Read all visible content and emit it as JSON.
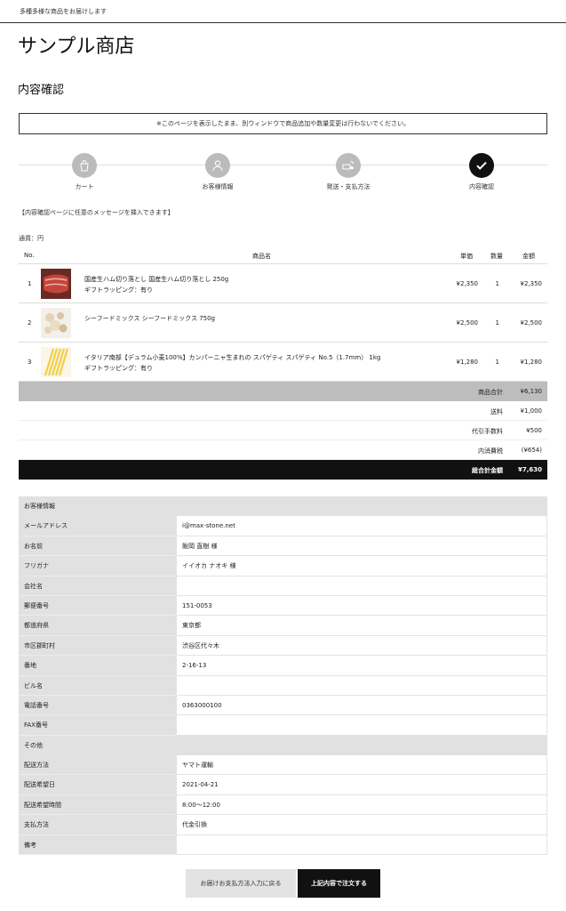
{
  "topbar": {
    "tagline": "多種多様な商品をお届けします"
  },
  "shop": {
    "title": "サンプル商店"
  },
  "page": {
    "title": "内容確認",
    "notice": "※このページを表示したまま、別ウィンドウで商品追加や数量変更は行わないでください。",
    "message": "【内容確認ページに任意のメッセージを挿入できます】",
    "currency": "通貨：円"
  },
  "steps": [
    {
      "label": "カート",
      "icon": "bag-icon"
    },
    {
      "label": "お客様情報",
      "icon": "user-icon"
    },
    {
      "label": "発送・支払方法",
      "icon": "truck-icon"
    },
    {
      "label": "内容確認",
      "icon": "check-icon",
      "active": true
    }
  ],
  "products": {
    "headers": {
      "no": "No.",
      "name": "商品名",
      "price": "単価",
      "qty": "数量",
      "amount": "金額"
    },
    "rows": [
      {
        "no": "1",
        "name": "国産生ハム切り落とし 国産生ハム切り落とし 250g",
        "option": "ギフトラッピング：有り",
        "price": "¥2,350",
        "qty": "1",
        "amount": "¥2,350",
        "thumb": "ham"
      },
      {
        "no": "2",
        "name": "シーフードミックス シーフードミックス 750g",
        "option": "",
        "price": "¥2,500",
        "qty": "1",
        "amount": "¥2,500",
        "thumb": "seafood"
      },
      {
        "no": "3",
        "name": "イタリア南部【デュラム小麦100%】カンパーニャ生まれの スパゲティ スパゲティ No.5（1.7mm） 1kg",
        "option": "ギフトラッピング：有り",
        "price": "¥1,280",
        "qty": "1",
        "amount": "¥1,280",
        "thumb": "pasta"
      }
    ]
  },
  "summary": {
    "subtotal_label": "商品合計",
    "subtotal": "¥6,130",
    "shipping_label": "送料",
    "shipping": "¥1,000",
    "cod_label": "代引手数料",
    "cod": "¥500",
    "tax_label": "内消費税",
    "tax": "(¥654)",
    "total_label": "総合計金額",
    "total": "¥7,630"
  },
  "customer": {
    "section_title": "お客様情報",
    "rows": [
      {
        "label": "メールアドレス",
        "value": "i@max-stone.net"
      },
      {
        "label": "お名前",
        "value": "飯岡 直樹 様"
      },
      {
        "label": "フリガナ",
        "value": "イイオカ ナオキ 様"
      },
      {
        "label": "会社名",
        "value": ""
      },
      {
        "label": "郵便番号",
        "value": "151-0053"
      },
      {
        "label": "都道府県",
        "value": "東京都"
      },
      {
        "label": "市区郡町村",
        "value": "渋谷区代々木"
      },
      {
        "label": "番地",
        "value": "2-16-13"
      },
      {
        "label": "ビル名",
        "value": ""
      },
      {
        "label": "電話番号",
        "value": "0363000100"
      },
      {
        "label": "FAX番号",
        "value": ""
      }
    ],
    "other_title": "その他",
    "other_rows": [
      {
        "label": "配送方法",
        "value": "ヤマト運輸"
      },
      {
        "label": "配送希望日",
        "value": "2021-04-21"
      },
      {
        "label": "配送希望時間",
        "value": "8:00～12:00"
      },
      {
        "label": "支払方法",
        "value": "代金引換"
      },
      {
        "label": "備考",
        "value": ""
      }
    ]
  },
  "buttons": {
    "back": "お届けお支払方法入力に戻る",
    "order": "上記内容で注文する"
  },
  "colors": {
    "step_inactive": "#bbbbbb",
    "step_active": "#111111",
    "subtotal_bg": "#bdbdbd",
    "total_bg": "#111111",
    "label_bg": "#e1e1e1"
  }
}
